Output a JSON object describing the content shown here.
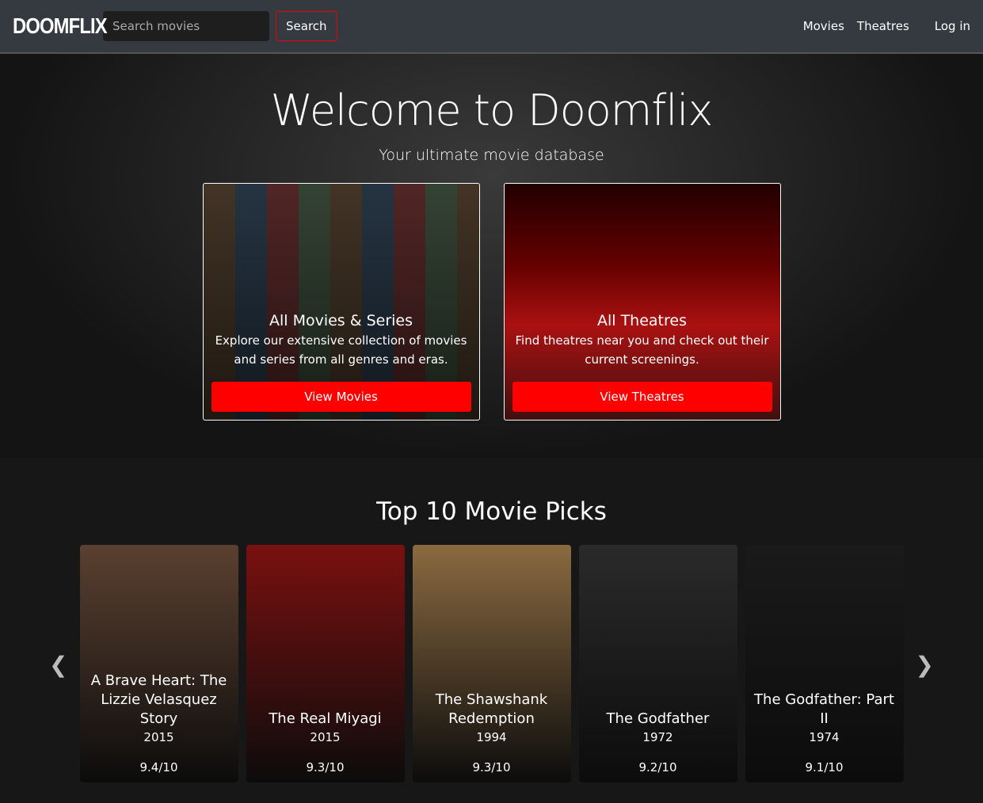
{
  "nav": {
    "logo": "DOOMFLIX",
    "search_placeholder": "Search movies",
    "search_label": "Search",
    "links": [
      "Movies",
      "Theatres",
      "Log in"
    ]
  },
  "hero": {
    "title": "Welcome to Doomflix",
    "subtitle": "Your ultimate movie database",
    "cards": [
      {
        "title": "All Movies & Series",
        "text": "Explore our extensive collection of movies and series from all genres and eras.",
        "button": "View Movies"
      },
      {
        "title": "All Theatres",
        "text": "Find theatres near you and check out their current screenings.",
        "button": "View Theatres"
      }
    ]
  },
  "top": {
    "title": "Top 10 Movie Picks",
    "movies": [
      {
        "title": "A Brave Heart: The Lizzie Velasquez Story",
        "year": "2015",
        "rating": "9.4/10",
        "color": "#5a4030"
      },
      {
        "title": "The Real Miyagi",
        "year": "2015",
        "rating": "9.3/10",
        "color": "#7a1010"
      },
      {
        "title": "The Shawshank Redemption",
        "year": "1994",
        "rating": "9.3/10",
        "color": "#8a6a40"
      },
      {
        "title": "The Godfather",
        "year": "1972",
        "rating": "9.2/10",
        "color": "#2a2a2a"
      },
      {
        "title": "The Godfather: Part II",
        "year": "1974",
        "rating": "9.1/10",
        "color": "#1a1a1a"
      }
    ]
  }
}
